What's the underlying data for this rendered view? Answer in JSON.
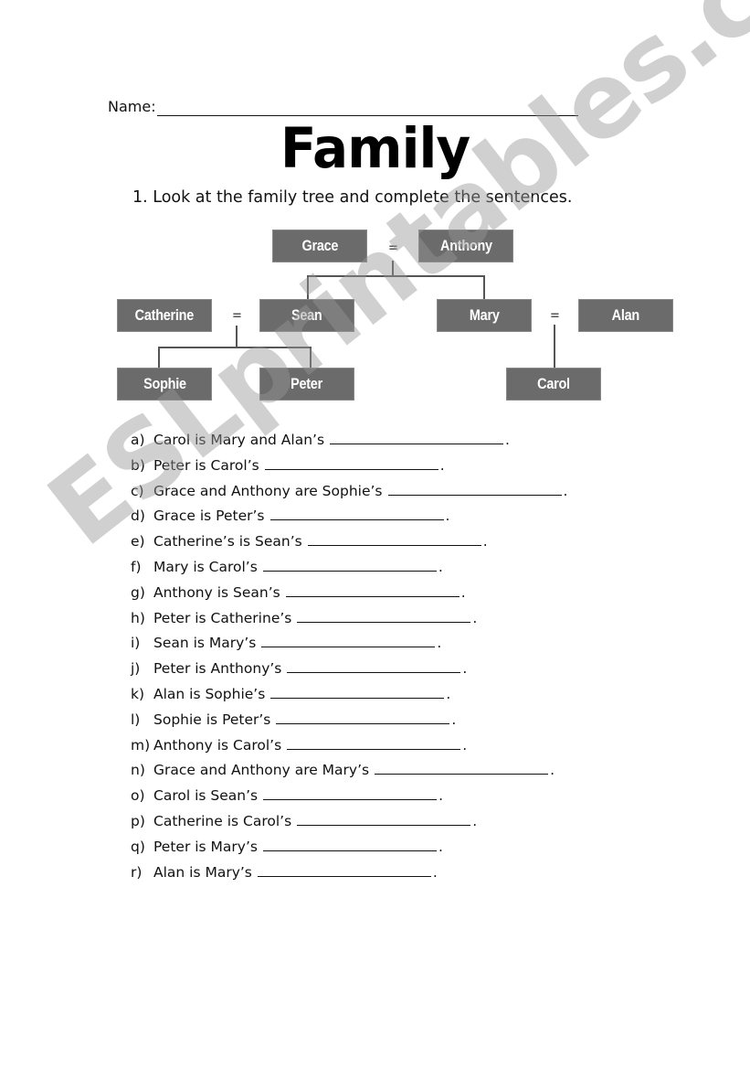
{
  "header": {
    "name_label": "Name:",
    "title": "Family",
    "instruction": "1.  Look at the family tree and complete the sentences."
  },
  "tree": {
    "nodes": {
      "grace": "Grace",
      "anthony": "Anthony",
      "catherine": "Catherine",
      "sean": "Sean",
      "mary": "Mary",
      "alan": "Alan",
      "sophie": "Sophie",
      "peter": "Peter",
      "carol": "Carol"
    },
    "marriage_symbol": "="
  },
  "questions": [
    {
      "label": "a)",
      "text": "Carol is Mary and Alan’s",
      "blank_width": 190
    },
    {
      "label": "b)",
      "text": "Peter is Carol’s",
      "blank_width": 190
    },
    {
      "label": "c)",
      "text": "Grace and Anthony are Sophie’s",
      "blank_width": 190
    },
    {
      "label": "d)",
      "text": "Grace is Peter’s",
      "blank_width": 190
    },
    {
      "label": "e)",
      "text": "Catherine’s is Sean’s",
      "blank_width": 190
    },
    {
      "label": "f)",
      "text": "Mary is Carol’s",
      "blank_width": 190
    },
    {
      "label": "g)",
      "text": "Anthony is Sean’s",
      "blank_width": 190
    },
    {
      "label": "h)",
      "text": "Peter is Catherine’s",
      "blank_width": 190
    },
    {
      "label": "i)",
      "text": "Sean is Mary’s",
      "blank_width": 190
    },
    {
      "label": "j)",
      "text": "Peter is Anthony’s",
      "blank_width": 190
    },
    {
      "label": "k)",
      "text": "Alan is Sophie’s",
      "blank_width": 190
    },
    {
      "label": "l)",
      "text": "Sophie is Peter’s",
      "blank_width": 190
    },
    {
      "label": "m)",
      "text": "Anthony is Carol’s",
      "blank_width": 190
    },
    {
      "label": "n)",
      "text": "Grace and Anthony are Mary’s",
      "blank_width": 190
    },
    {
      "label": "o)",
      "text": "Carol is Sean’s",
      "blank_width": 190
    },
    {
      "label": "p)",
      "text": "Catherine is Carol’s",
      "blank_width": 190
    },
    {
      "label": "q)",
      "text": "Peter is Mary’s",
      "blank_width": 190
    },
    {
      "label": "r)",
      "text": "Alan is Mary’s",
      "blank_width": 190
    }
  ],
  "sentence_end": ".",
  "watermark": "ESLprintables.com"
}
